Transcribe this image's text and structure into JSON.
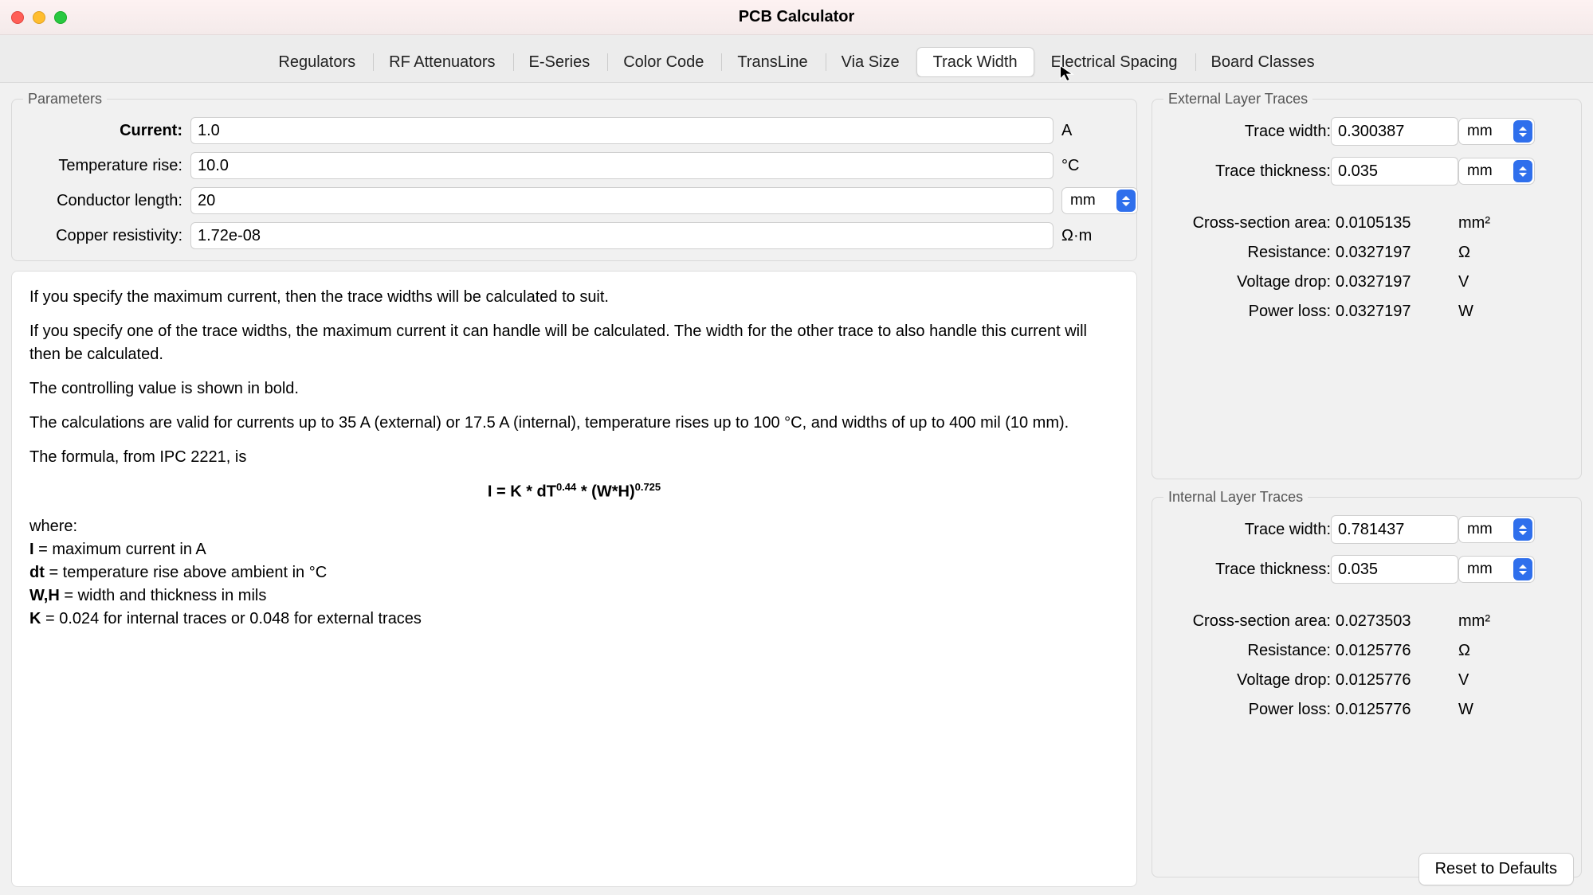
{
  "window": {
    "title": "PCB Calculator"
  },
  "tabs": [
    {
      "label": "Regulators"
    },
    {
      "label": "RF Attenuators"
    },
    {
      "label": "E-Series"
    },
    {
      "label": "Color Code"
    },
    {
      "label": "TransLine"
    },
    {
      "label": "Via Size"
    },
    {
      "label": "Track Width"
    },
    {
      "label": "Electrical Spacing"
    },
    {
      "label": "Board Classes"
    }
  ],
  "active_tab": "Track Width",
  "parameters": {
    "legend": "Parameters",
    "current": {
      "label": "Current:",
      "value": "1.0",
      "unit": "A"
    },
    "temperature_rise": {
      "label": "Temperature rise:",
      "value": "10.0",
      "unit": "°C"
    },
    "conductor_length": {
      "label": "Conductor length:",
      "value": "20",
      "unit": "mm"
    },
    "copper_resistivity": {
      "label": "Copper resistivity:",
      "value": "1.72e-08",
      "unit": "Ω·m"
    }
  },
  "info": {
    "p1": "If you specify the maximum current, then the trace widths will be calculated to suit.",
    "p2": "If you specify one of the trace widths, the maximum current it can handle will be calculated. The width for the other trace to also handle this current will then be calculated.",
    "p3": "The controlling value is shown in bold.",
    "p4": "The calculations are valid for currents up to 35 A (external) or 17.5 A (internal), temperature rises up to 100 °C, and widths of up to 400 mil (10 mm).",
    "p5": "The formula, from IPC 2221, is",
    "formula_prefix": "I = K * dT",
    "formula_exp1": "0.44",
    "formula_mid": " * (W*H)",
    "formula_exp2": "0.725",
    "where": "where:",
    "l1a": "I",
    "l1b": " = maximum current in A",
    "l2a": "dt",
    "l2b": " = temperature rise above ambient in °C",
    "l3a": "W,H",
    "l3b": " = width and thickness in mils",
    "l4a": "K",
    "l4b": " = 0.024 for internal traces or 0.048 for external traces"
  },
  "external": {
    "legend": "External Layer Traces",
    "trace_width": {
      "label": "Trace width:",
      "value": "0.300387",
      "unit": "mm"
    },
    "trace_thickness": {
      "label": "Trace thickness:",
      "value": "0.035",
      "unit": "mm"
    },
    "cross_section": {
      "label": "Cross-section area:",
      "value": "0.0105135",
      "unit": "mm²"
    },
    "resistance": {
      "label": "Resistance:",
      "value": "0.0327197",
      "unit": "Ω"
    },
    "voltage_drop": {
      "label": "Voltage drop:",
      "value": "0.0327197",
      "unit": "V"
    },
    "power_loss": {
      "label": "Power loss:",
      "value": "0.0327197",
      "unit": "W"
    }
  },
  "internal": {
    "legend": "Internal Layer Traces",
    "trace_width": {
      "label": "Trace width:",
      "value": "0.781437",
      "unit": "mm"
    },
    "trace_thickness": {
      "label": "Trace thickness:",
      "value": "0.035",
      "unit": "mm"
    },
    "cross_section": {
      "label": "Cross-section area:",
      "value": "0.0273503",
      "unit": "mm²"
    },
    "resistance": {
      "label": "Resistance:",
      "value": "0.0125776",
      "unit": "Ω"
    },
    "voltage_drop": {
      "label": "Voltage drop:",
      "value": "0.0125776",
      "unit": "V"
    },
    "power_loss": {
      "label": "Power loss:",
      "value": "0.0125776",
      "unit": "W"
    }
  },
  "reset_label": "Reset to Defaults"
}
